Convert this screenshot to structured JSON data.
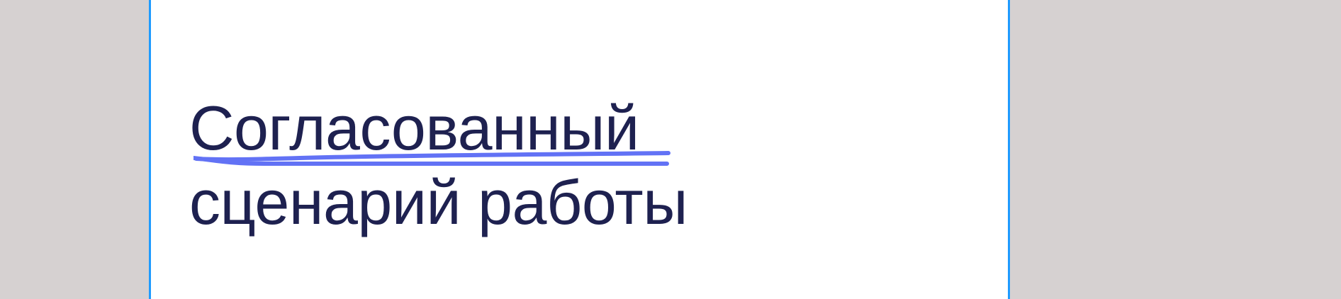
{
  "slide": {
    "title_line1": "Согласованный",
    "title_line2": "сценарий работы"
  },
  "colors": {
    "text": "#1e2150",
    "underline": "#6272f5",
    "frame_border": "#1f9bff",
    "background": "#d6d1d1"
  }
}
